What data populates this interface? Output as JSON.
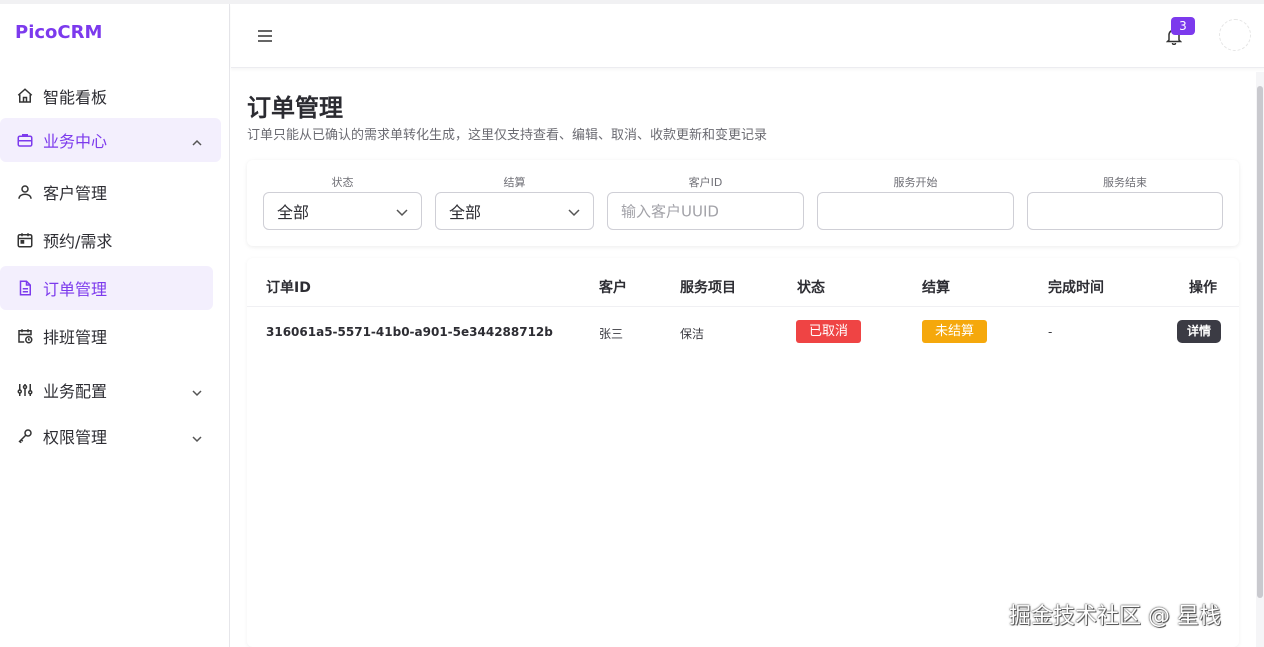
{
  "app": {
    "brand": "PicoCRM"
  },
  "sidebar": {
    "items": [
      {
        "label": "智能看板"
      },
      {
        "label": "业务中心"
      },
      {
        "label": "客户管理"
      },
      {
        "label": "预约/需求"
      },
      {
        "label": "订单管理"
      },
      {
        "label": "排班管理"
      },
      {
        "label": "业务配置"
      },
      {
        "label": "权限管理"
      }
    ]
  },
  "header": {
    "notification_count": "3"
  },
  "page": {
    "title": "订单管理",
    "subtitle": "订单只能从已确认的需求单转化生成，这里仅支持查看、编辑、取消、收款更新和变更记录"
  },
  "filters": {
    "status": {
      "label": "状态",
      "value": "全部"
    },
    "settlement": {
      "label": "结算",
      "value": "全部"
    },
    "customer_id": {
      "label": "客户ID",
      "placeholder": "输入客户UUID",
      "value": ""
    },
    "service_start": {
      "label": "服务开始",
      "value": ""
    },
    "service_end": {
      "label": "服务结束",
      "value": ""
    }
  },
  "table": {
    "columns": [
      "订单ID",
      "客户",
      "服务项目",
      "状态",
      "结算",
      "完成时间",
      "操作"
    ],
    "rows": [
      {
        "order_id": "316061a5-5571-41b0-a901-5e344288712b",
        "customer": "张三",
        "service": "保洁",
        "status": "已取消",
        "settlement": "未结算",
        "completed_at": "-",
        "action": "详情"
      }
    ]
  },
  "colors": {
    "accent": "#7c3aed",
    "status_cancelled": "#ef4444",
    "settlement_unpaid": "#f5a80c",
    "detail_button": "#3b3b44"
  },
  "watermark": "掘金技术社区 @ 星栈"
}
